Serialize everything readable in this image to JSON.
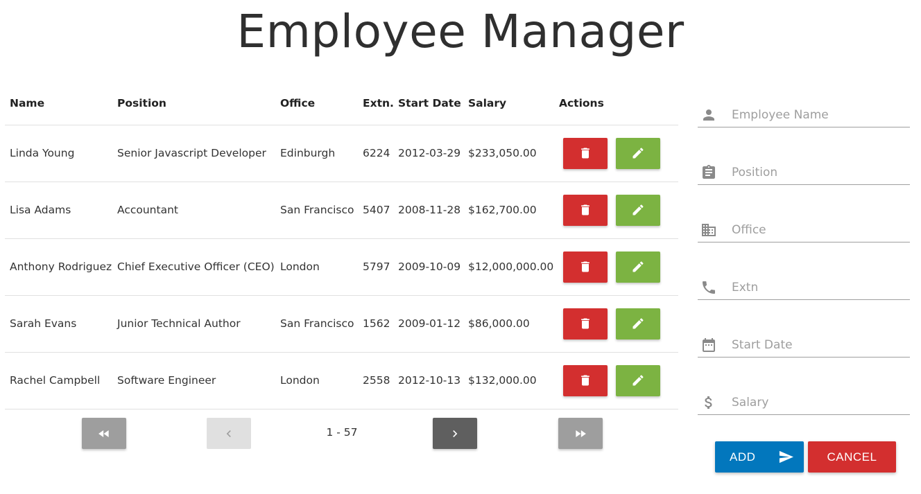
{
  "app": {
    "title": "Employee Manager"
  },
  "table": {
    "headers": [
      "Name",
      "Position",
      "Office",
      "Extn.",
      "Start Date",
      "Salary",
      "Actions"
    ],
    "rows": [
      [
        "Linda Young",
        "Senior Javascript Developer",
        "Edinburgh",
        "6224",
        "2012-03-29",
        "$233,050.00"
      ],
      [
        "Lisa Adams",
        "Accountant",
        "San Francisco",
        "5407",
        "2008-11-28",
        "$162,700.00"
      ],
      [
        "Anthony Rodriguez",
        "Chief Executive Officer (CEO)",
        "London",
        "5797",
        "2009-10-09",
        "$12,000,000.00"
      ],
      [
        "Sarah Evans",
        "Junior Technical Author",
        "San Francisco",
        "1562",
        "2009-01-12",
        "$86,000.00"
      ],
      [
        "Rachel Campbell",
        "Software Engineer",
        "London",
        "2558",
        "2012-10-13",
        "$132,000.00"
      ]
    ],
    "row_actions": {
      "delete_icon": "trash-icon",
      "edit_icon": "pencil-icon"
    }
  },
  "pagination": {
    "range_label": "1 - 57"
  },
  "form": {
    "fields": [
      {
        "placeholder": "Employee Name",
        "icon": "person-icon"
      },
      {
        "placeholder": "Position",
        "icon": "clipboard-icon"
      },
      {
        "placeholder": "Office",
        "icon": "building-icon"
      },
      {
        "placeholder": "Extn",
        "icon": "phone-icon"
      },
      {
        "placeholder": "Start Date",
        "icon": "calendar-icon"
      },
      {
        "placeholder": "Salary",
        "icon": "dollar-icon"
      }
    ],
    "add_label": "ADD",
    "cancel_label": "CANCEL"
  },
  "colors": {
    "delete": "#d32f2f",
    "edit": "#7cb342",
    "add": "#0277bd",
    "cancel": "#d32f2f",
    "pager_active": "#5f5f5f",
    "pager_disabled": "#e0e0e0",
    "pager_default": "#9e9e9e"
  }
}
